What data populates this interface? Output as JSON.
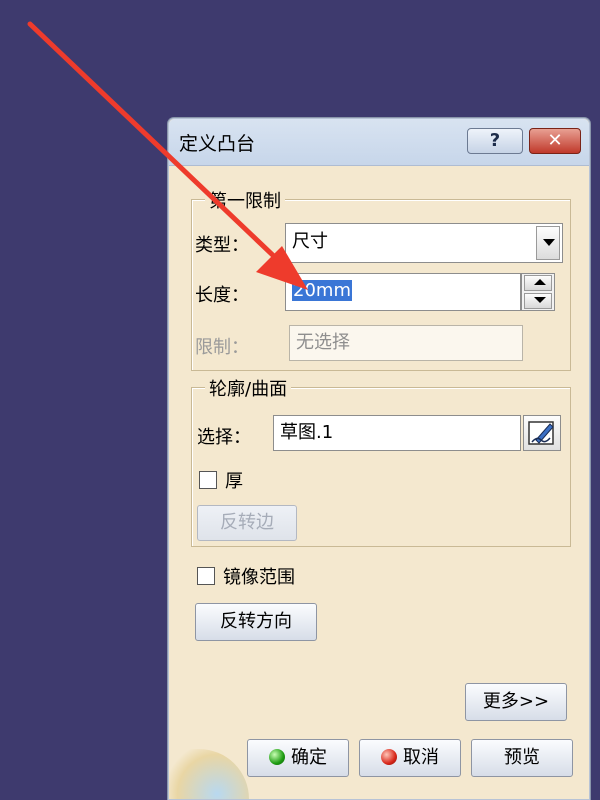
{
  "dialog": {
    "title": "定义凸台",
    "help_label": "?",
    "close_label": "✕"
  },
  "first_limit": {
    "legend": "第一限制",
    "type_label": "类型：",
    "type_value": "尺寸",
    "length_label": "长度：",
    "length_value_selected": "20mm",
    "limit_label": "限制：",
    "limit_value": "无选择"
  },
  "profile": {
    "legend": "轮廓/曲面",
    "select_label": "选择：",
    "select_value": "草图.1",
    "thick_label": "厚",
    "reverse_side_label": "反转边"
  },
  "mirror_label": "镜像范围",
  "reverse_direction_label": "反转方向",
  "more_label": "更多>>",
  "footer": {
    "ok_label": "确定",
    "cancel_label": "取消",
    "preview_label": "预览"
  },
  "colors": {
    "background": "#3e3a6e",
    "dialog": "#f4e8cf",
    "annotation_arrow": "#ee3b2c",
    "selection": "#3a76d6"
  }
}
